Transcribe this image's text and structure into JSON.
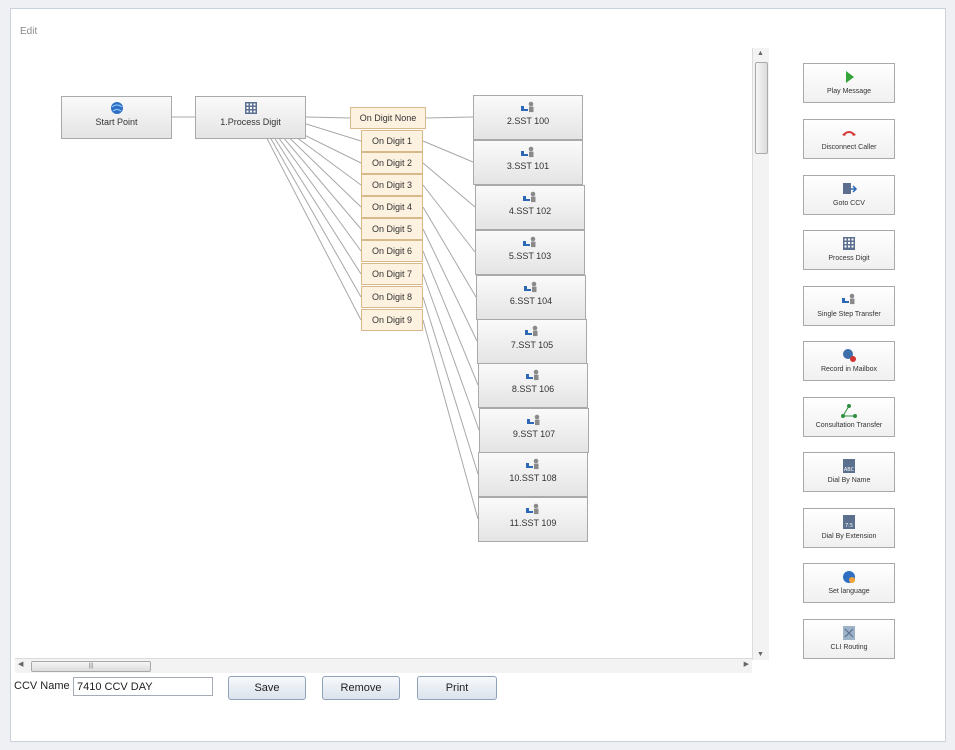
{
  "panel": {
    "title": "Edit"
  },
  "start_node": {
    "label": "Start Point",
    "icon": "globe-icon"
  },
  "process_node": {
    "label": "1.Process Digit",
    "icon": "keypad-icon"
  },
  "digit_options": [
    "On Digit None",
    "On Digit 1",
    "On Digit 2",
    "On Digit 3",
    "On Digit 4",
    "On Digit 5",
    "On Digit 6",
    "On Digit 7",
    "On Digit 8",
    "On Digit 9"
  ],
  "sst_nodes": [
    "2.SST 100",
    "3.SST 101",
    "4.SST 102",
    "5.SST 103",
    "6.SST 104",
    "7.SST 105",
    "8.SST 106",
    "9.SST 107",
    "10.SST 108",
    "11.SST 109"
  ],
  "palette": [
    {
      "label": "Play Message",
      "icon": "play-icon"
    },
    {
      "label": "Disconnect Caller",
      "icon": "hangup-icon"
    },
    {
      "label": "Goto CCV",
      "icon": "goto-icon"
    },
    {
      "label": "Process Digit",
      "icon": "keypad-icon"
    },
    {
      "label": "Single Step Transfer",
      "icon": "transfer-icon"
    },
    {
      "label": "Record in Mailbox",
      "icon": "record-icon"
    },
    {
      "label": "Consultation Transfer",
      "icon": "consult-icon"
    },
    {
      "label": "Dial By Name",
      "icon": "dial-name-icon"
    },
    {
      "label": "Dial By Extension",
      "icon": "dial-extension-icon"
    },
    {
      "label": "Set language",
      "icon": "language-icon"
    },
    {
      "label": "CLI Routing",
      "icon": "routing-icon"
    }
  ],
  "footer": {
    "name_label": "CCV Name",
    "name_value": "7410 CCV DAY",
    "save": "Save",
    "remove": "Remove",
    "print": "Print"
  },
  "colors": {
    "digit_fill": "#fdf1df",
    "node_fill": "#e8e8e8",
    "button_fill": "#dbe3ec"
  }
}
